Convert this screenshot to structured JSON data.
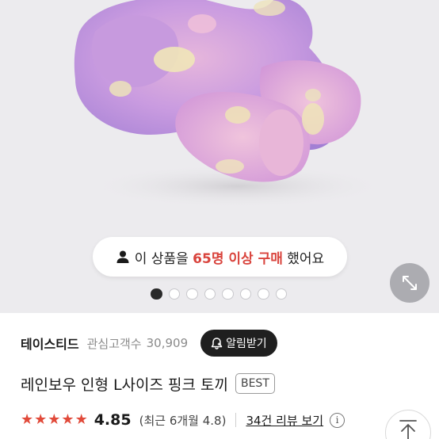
{
  "buyer_banner": {
    "prefix": "이 상품을 ",
    "highlight": "65명 이상 구매",
    "suffix": " 했어요"
  },
  "carousel": {
    "total": 8,
    "active_index": 0
  },
  "shop": {
    "name": "테이스티드",
    "favorite_label": "관심고객수",
    "favorite_count": "30,909",
    "notify_label": "알림받기"
  },
  "product": {
    "title": "레인보우 인형 L사이즈 핑크 토끼",
    "badge": "BEST"
  },
  "rating": {
    "stars": 5,
    "score": "4.85",
    "recent": "(최근 6개월 4.8)",
    "reviews_link": "34건 리뷰 보기",
    "info_symbol": "i"
  },
  "colors": {
    "accent_red": "#d9443d",
    "star_red": "#e14a3a",
    "dark_button": "#1f1f1f",
    "hero_bg": "#ecebee"
  },
  "icons": [
    "person-icon",
    "expand-icon",
    "bell-icon",
    "star-icon",
    "info-icon",
    "arrow-up-icon"
  ]
}
